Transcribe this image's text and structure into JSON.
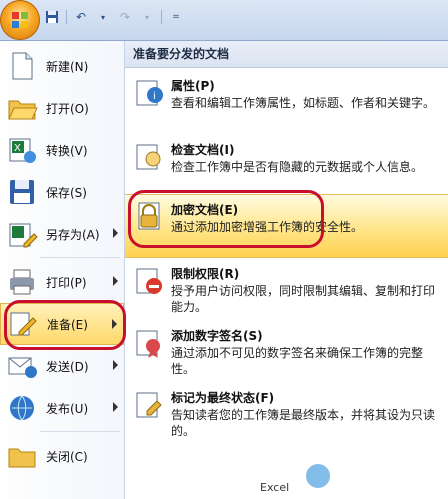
{
  "quick_access": {
    "save_icon": "save-icon",
    "undo_icon": "undo-icon",
    "redo_icon": "redo-icon",
    "customize_icon": "dropdown-icon"
  },
  "left_menu": [
    {
      "label": "新建(N)",
      "icon": "new-document-icon",
      "arrow": false
    },
    {
      "label": "打开(O)",
      "icon": "open-folder-icon",
      "arrow": false
    },
    {
      "label": "转换(V)",
      "icon": "convert-icon",
      "arrow": false
    },
    {
      "label": "保存(S)",
      "icon": "save-disk-icon",
      "arrow": false
    },
    {
      "label": "另存为(A)",
      "icon": "save-as-icon",
      "arrow": true
    },
    {
      "label": "打印(P)",
      "icon": "printer-icon",
      "arrow": true
    },
    {
      "label": "准备(E)",
      "icon": "prepare-pencil-icon",
      "arrow": true,
      "active": true
    },
    {
      "label": "发送(D)",
      "icon": "send-icon",
      "arrow": true
    },
    {
      "label": "发布(U)",
      "icon": "publish-icon",
      "arrow": true
    },
    {
      "label": "关闭(C)",
      "icon": "close-folder-icon",
      "arrow": false
    }
  ],
  "right_panel": {
    "header": "准备要分发的文档",
    "items": [
      {
        "title": "属性(P)",
        "desc": "查看和编辑工作簿属性，如标题、作者和关键字。",
        "icon": "properties-icon"
      },
      {
        "title": "检查文档(I)",
        "desc": "检查工作簿中是否有隐藏的元数据或个人信息。",
        "icon": "inspect-document-icon"
      },
      {
        "title": "加密文档(E)",
        "desc": "通过添加加密增强工作簿的安全性。",
        "icon": "encrypt-lock-icon",
        "active": true
      },
      {
        "title": "限制权限(R)",
        "desc": "授予用户访问权限，同时限制其编辑、复制和打印能力。",
        "icon": "restrict-permission-icon"
      },
      {
        "title": "添加数字签名(S)",
        "desc": "通过添加不可见的数字签名来确保工作簿的完整性。",
        "icon": "digital-signature-icon"
      },
      {
        "title": "标记为最终状态(F)",
        "desc": "告知读者您的工作簿是最终版本，并将其设为只读的。",
        "icon": "mark-final-icon"
      }
    ]
  },
  "bottom_hint": "Excel",
  "colors": {
    "highlight_ring": "#c8102e",
    "active_bg": "#ffd86a"
  }
}
